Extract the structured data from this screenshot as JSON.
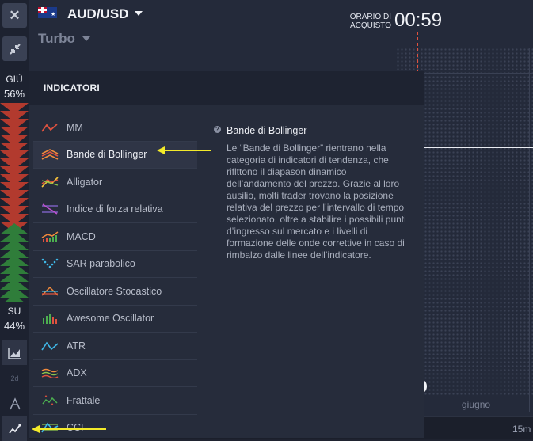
{
  "header": {
    "asset": "AUD/USD",
    "mode": "Turbo",
    "buy_time_label": "ORARIO DI ACQUISTO",
    "buy_time": "00:59"
  },
  "sidebar": {
    "down_label": "GIÙ",
    "down_pct": "56%",
    "up_label": "SU",
    "up_pct": "44%"
  },
  "chart": {
    "month_label": "giugno",
    "timeframe": "15m"
  },
  "panel": {
    "title": "INDICATORI",
    "items": [
      {
        "label": "MM",
        "icon": "moving-average-icon"
      },
      {
        "label": "Bande di Bollinger",
        "icon": "bollinger-bands-icon"
      },
      {
        "label": "Alligator",
        "icon": "alligator-icon"
      },
      {
        "label": "Indice di forza relativa",
        "icon": "rsi-icon"
      },
      {
        "label": "MACD",
        "icon": "macd-icon"
      },
      {
        "label": "SAR parabolico",
        "icon": "parabolic-sar-icon"
      },
      {
        "label": "Oscillatore Stocastico",
        "icon": "stochastic-icon"
      },
      {
        "label": "Awesome Oscillator",
        "icon": "awesome-oscillator-icon"
      },
      {
        "label": "ATR",
        "icon": "atr-icon"
      },
      {
        "label": "ADX",
        "icon": "adx-icon"
      },
      {
        "label": "Frattale",
        "icon": "fractal-icon"
      },
      {
        "label": "CCI",
        "icon": "cci-icon"
      }
    ],
    "selected": "Bande di Bollinger",
    "description_title": "Bande di Bollinger",
    "description_text": "Le “Bande di Bollinger” rientrano nella categoria di indicatori di tendenza, che riflttono il diapason dinamico dell’andamento del prezzo. Grazie al loro ausilio, molti trader trovano la posizione relativa del prezzo per l’intervallo di tempo selezionato, oltre a stabilire i possibili punti d’ingresso sul mercato e i livelli di formazione delle onde correttive in caso di rimbalzo dalle linee dell’indicatore."
  },
  "colors": {
    "down": "#b23a2e",
    "up": "#2f7d3a",
    "annotation_arrow": "#f3ea2a",
    "accent_orange": "#f08a3c"
  }
}
